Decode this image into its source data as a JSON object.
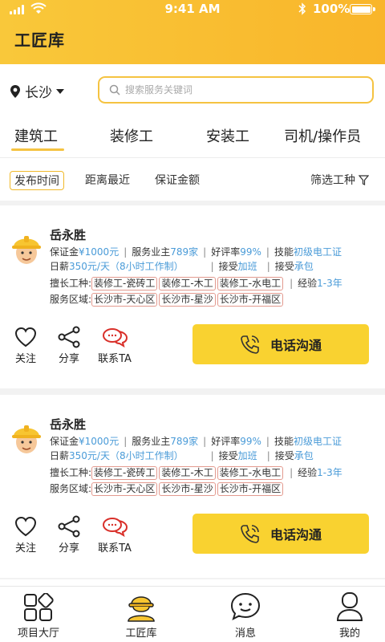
{
  "status_bar": {
    "time": "9:41 AM",
    "battery": "100%"
  },
  "app": {
    "title": "工匠库"
  },
  "location": {
    "city": "长沙"
  },
  "search": {
    "placeholder": "搜索服务关键词"
  },
  "tabs": [
    {
      "label": "建筑工",
      "active": true
    },
    {
      "label": "装修工",
      "active": false
    },
    {
      "label": "安装工",
      "active": false
    },
    {
      "label": "司机/操作员",
      "active": false
    }
  ],
  "filters": {
    "items": [
      {
        "label": "发布时间",
        "active": true
      },
      {
        "label": "距离最近",
        "active": false
      },
      {
        "label": "保证金额",
        "active": false
      }
    ],
    "right_label": "筛选工种"
  },
  "workers": [
    {
      "name": "岳永胜",
      "deposit_label": "保证金",
      "deposit_value": "¥1000元",
      "served_label": "服务业主",
      "served_value": "789家",
      "rating_label": "好评率",
      "rating_value": "99%",
      "skill_label": "技能",
      "skill_value": "初级电工证",
      "wage_label": "日薪",
      "wage_value": "350元/天（8小时工作制）",
      "overtime_label": "接受",
      "overtime_value": "加班",
      "contract_label": "接受",
      "contract_value": "承包",
      "specialty_label": "擅长工种:",
      "specialties": [
        "装修工-瓷砖工",
        "装修工-木工",
        "装修工-水电工"
      ],
      "experience_label": "经验",
      "experience_value": "1-3年",
      "area_label": "服务区域:",
      "areas": [
        "长沙市-天心区",
        "长沙市-星沙",
        "长沙市-开福区"
      ],
      "follow_label": "关注",
      "share_label": "分享",
      "contact_label": "联系TA",
      "call_label": "电话沟通"
    },
    {
      "name": "岳永胜",
      "deposit_label": "保证金",
      "deposit_value": "¥1000元",
      "served_label": "服务业主",
      "served_value": "789家",
      "rating_label": "好评率",
      "rating_value": "99%",
      "skill_label": "技能",
      "skill_value": "初级电工证",
      "wage_label": "日薪",
      "wage_value": "350元/天（8小时工作制）",
      "overtime_label": "接受",
      "overtime_value": "加班",
      "contract_label": "接受",
      "contract_value": "承包",
      "specialty_label": "擅长工种:",
      "specialties": [
        "装修工-瓷砖工",
        "装修工-木工",
        "装修工-水电工"
      ],
      "experience_label": "经验",
      "experience_value": "1-3年",
      "area_label": "服务区域:",
      "areas": [
        "长沙市-天心区",
        "长沙市-星沙",
        "长沙市-开福区"
      ],
      "follow_label": "关注",
      "share_label": "分享",
      "contact_label": "联系TA",
      "call_label": "电话沟通"
    }
  ],
  "bottom_nav": [
    {
      "label": "项目大厅",
      "icon": "grid-icon",
      "active": false
    },
    {
      "label": "工匠库",
      "icon": "worker-icon",
      "active": true
    },
    {
      "label": "消息",
      "icon": "chat-bubble-icon",
      "active": false
    },
    {
      "label": "我的",
      "icon": "user-icon",
      "active": false
    }
  ],
  "colors": {
    "brand": "#f9c83a",
    "accent_blue": "#4a9bd8",
    "tag_border": "#e39a8f",
    "call_button": "#f9d230"
  }
}
